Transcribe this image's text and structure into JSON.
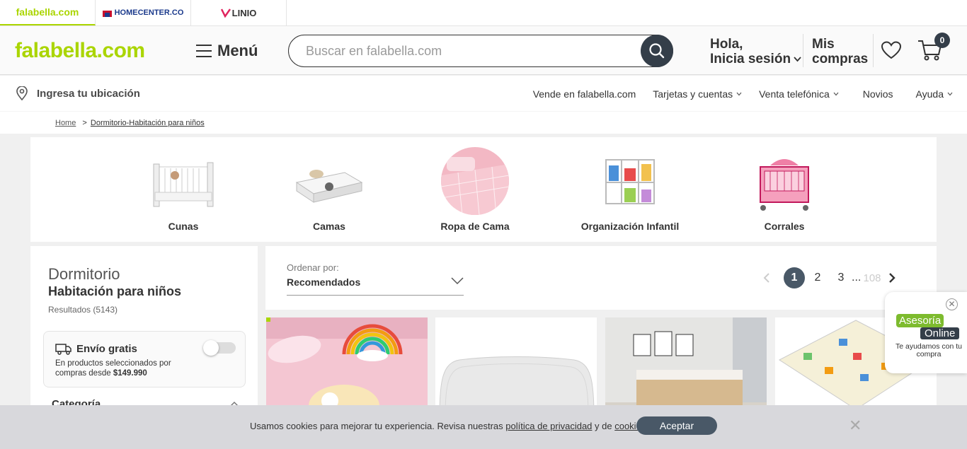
{
  "brands": [
    {
      "label": "falabella.com"
    },
    {
      "label": "HOMECENTER.CO"
    },
    {
      "label": "LINIO"
    }
  ],
  "header": {
    "logo": "falabella.com",
    "menu_label": "Menú",
    "search_placeholder": "Buscar en falabella.com",
    "greeting": "Hola,",
    "login": "Inicia sesión",
    "orders_line1": "Mis",
    "orders_line2": "compras",
    "cart_count": "0"
  },
  "subnav": {
    "location": "Ingresa tu ubicación",
    "links": [
      "Vende en falabella.com",
      "Tarjetas y cuentas",
      "Venta telefónica",
      "Novios",
      "Ayuda"
    ]
  },
  "breadcrumb": {
    "home": "Home",
    "sep": ">",
    "current": "Dormitorio-Habitación para niños"
  },
  "categories": [
    {
      "label": "Cunas"
    },
    {
      "label": "Camas"
    },
    {
      "label": "Ropa de Cama"
    },
    {
      "label": "Organización Infantil"
    },
    {
      "label": "Corrales"
    }
  ],
  "sidebar": {
    "title": "Dormitorio",
    "subtitle": "Habitación para niños",
    "results": "Resultados (5143)",
    "free_shipping": {
      "title": "Envío gratis",
      "desc_line1": "En productos seleccionados por",
      "desc_line2_prefix": "compras desde ",
      "amount": "$149.990",
      "enabled": false
    },
    "category_heading": "Categoría"
  },
  "sort": {
    "label": "Ordenar por:",
    "value": "Recomendados"
  },
  "pagination": {
    "current": "1",
    "pages": [
      "2",
      "3"
    ],
    "ellipsis": "...",
    "last": "108"
  },
  "cookie": {
    "text_a": "Usamos cookies para mejorar tu experiencia. Revisa nuestras ",
    "privacy_link": "política de privacidad",
    "text_b": " y de ",
    "cookies_link": "cookies",
    "text_c": ".",
    "accept": "Aceptar"
  },
  "chat": {
    "line1": "Asesoría",
    "line2": "Online",
    "caption": "Te ayudamos con tu compra"
  },
  "colors": {
    "brand_green": "#aad500",
    "dark": "#343e49",
    "button": "#495867"
  }
}
